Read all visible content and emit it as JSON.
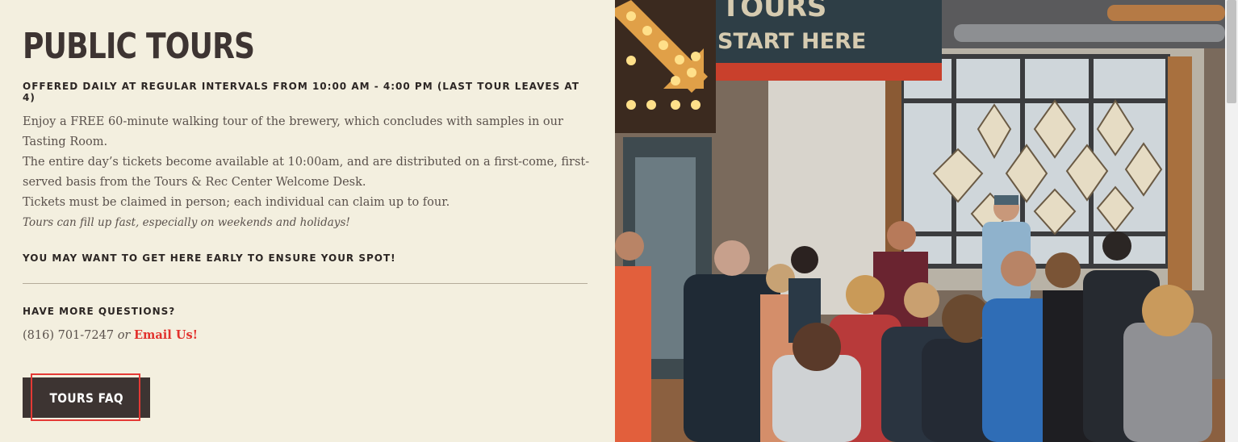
{
  "tours": {
    "title": "PUBLIC TOURS",
    "subhead": "OFFERED DAILY AT REGULAR INTERVALS FROM 10:00 AM - 4:00 PM (LAST TOUR LEAVES AT 4)",
    "paragraphs": [
      "Enjoy a FREE 60-minute walking tour of the brewery, which concludes with samples in our Tasting Room.",
      "The entire day’s tickets become available at 10:00am, and are distributed on a first-come, first-served basis from the Tours & Rec Center Welcome Desk.",
      "Tickets must be claimed in person; each individual can claim up to four."
    ],
    "italic_note": "Tours can fill up fast, especially on weekends and holidays!",
    "early_note": "YOU MAY WANT TO GET HERE EARLY TO ENSURE YOUR SPOT!"
  },
  "questions": {
    "heading": "HAVE MORE QUESTIONS?",
    "phone": "(816) 701-7247",
    "or_text": "or",
    "email_link": "Email Us!"
  },
  "faq_button": {
    "label": "TOURS FAQ"
  },
  "photo": {
    "sign_text_top": "TOURS",
    "sign_text": "START HERE"
  },
  "colors": {
    "background": "#f3efdf",
    "heading": "#3d3432",
    "body_text": "#5a514c",
    "link": "#e2312d",
    "button_bg": "#3d3432",
    "highlight": "#e53935"
  }
}
